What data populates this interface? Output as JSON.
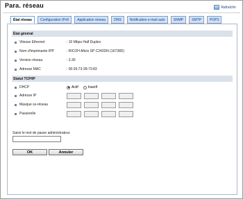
{
  "header": {
    "title": "Para. réseau",
    "refresh_label": "Rafraîchir"
  },
  "tabs": [
    {
      "label": "État réseau",
      "active": true
    },
    {
      "label": "Configuration IPv6",
      "active": false
    },
    {
      "label": "Application réseau",
      "active": false
    },
    {
      "label": "DNS",
      "active": false
    },
    {
      "label": "Notification e-mail auto",
      "active": false
    },
    {
      "label": "SNMP",
      "active": false
    },
    {
      "label": "SMTP",
      "active": false
    },
    {
      "label": "POP3",
      "active": false
    }
  ],
  "general": {
    "heading": "État général",
    "rows": [
      {
        "label": "Vitesse Ethernet",
        "value": ": 10 Mbps Half Duplex"
      },
      {
        "label": "Nom d'imprimante IPP",
        "value": ": RICOH Aficio SP C242DN (16738D)"
      },
      {
        "label": "Version réseau",
        "value": ": 3.30"
      },
      {
        "label": "Adresse MAC",
        "value": ": 00:26:73:1B:73:83"
      }
    ]
  },
  "tcpip": {
    "heading": "Statut TCP/IP",
    "dhcp_label": "DHCP",
    "dhcp_on_label": "Actif",
    "dhcp_off_label": "Inactif",
    "dhcp_selected": "Actif",
    "ip_label": "Adresse IP",
    "subnet_label": "Masque ss-réseau",
    "gateway_label": "Passerelle"
  },
  "auth": {
    "password_label": "Saisir le mot de passe administrateur.",
    "password_value": ""
  },
  "buttons": {
    "ok_label": "OK",
    "cancel_label": "Annuler"
  }
}
